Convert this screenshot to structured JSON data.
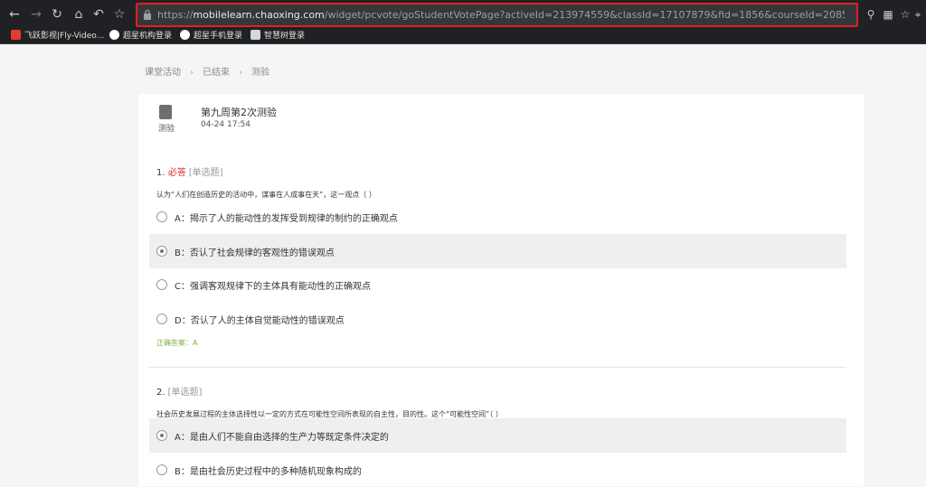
{
  "browser": {
    "url_scheme": "https://",
    "url_host": "mobilelearn.chaoxing.com",
    "url_path": "/widget/pcvote/goStudentVotePage?activeId=213974559&classId=17107879&fid=1856&courseId=208515862&quess..."
  },
  "bookmarks": [
    {
      "label": "飞跃影视|Fly-Video...",
      "color": "#e53935"
    },
    {
      "label": "超星机构登录",
      "color": "#ffffff"
    },
    {
      "label": "超星手机登录",
      "color": "#ffffff"
    },
    {
      "label": "智慧树登录",
      "color": "#cfd8dc"
    }
  ],
  "breadcrumb": [
    "课堂活动",
    "已结束",
    "测验"
  ],
  "quiz": {
    "icon_label": "测验",
    "title": "第九周第2次测验",
    "time": "04-24 17:54"
  },
  "questions": [
    {
      "number": "1.",
      "required": "必答",
      "type": "[单选题]",
      "stem": "认为“人们在创造历史的活动中，谋事在人成事在天”，这一观点（ ）",
      "options": [
        {
          "label": "A：揭示了人的能动性的发挥受到规律的制约的正确观点",
          "selected": false
        },
        {
          "label": "B：否认了社会规律的客观性的错误观点",
          "selected": true
        },
        {
          "label": "C：强调客观规律下的主体具有能动性的正确观点",
          "selected": false
        },
        {
          "label": "D：否认了人的主体自觉能动性的错误观点",
          "selected": false
        }
      ],
      "answer": "正确答案：A"
    },
    {
      "number": "2.",
      "required": "",
      "type": "[单选题]",
      "stem": "社会历史发展过程的主体选择性以一定的方式在可能性空间所表现的自主性，目的性。这个“可能性空间”（ ）",
      "options": [
        {
          "label": "A：是由人们不能自由选择的生产力等既定条件决定的",
          "selected": true
        },
        {
          "label": "B：是由社会历史过程中的多种随机现象构成的",
          "selected": false
        }
      ]
    }
  ],
  "colors": {
    "required": "#e02020",
    "answer": "#7cb342",
    "highlight_border": "#e02020"
  }
}
